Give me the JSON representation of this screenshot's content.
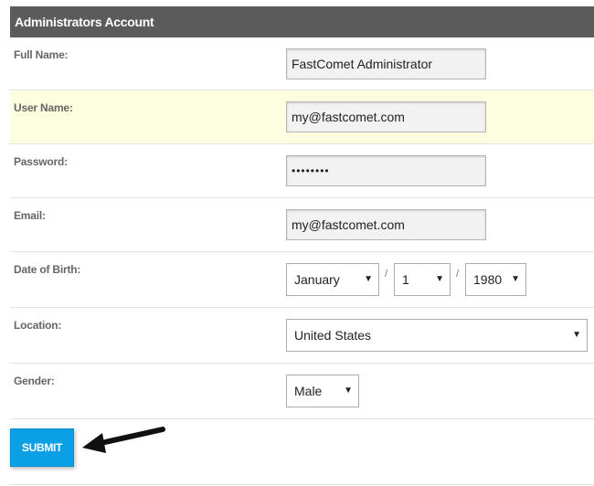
{
  "section_title": "Administrators Account",
  "fields": {
    "full_name": {
      "label": "Full Name:",
      "value": "FastComet Administrator"
    },
    "user_name": {
      "label": "User Name:",
      "value": "my@fastcomet.com"
    },
    "password": {
      "label": "Password:",
      "value": "••••••••"
    },
    "email": {
      "label": "Email:",
      "value": "my@fastcomet.com"
    },
    "dob": {
      "label": "Date of Birth:",
      "month": "January",
      "day": "1",
      "year": "1980",
      "separator": "/"
    },
    "location": {
      "label": "Location:",
      "value": "United States"
    },
    "gender": {
      "label": "Gender:",
      "value": "Male"
    }
  },
  "dropdown_arrow": "▼",
  "submit_label": "SUBMIT",
  "colors": {
    "header": "#5b5b5b",
    "highlight_row": "#fdfde0",
    "submit": "#0b9fe6"
  }
}
